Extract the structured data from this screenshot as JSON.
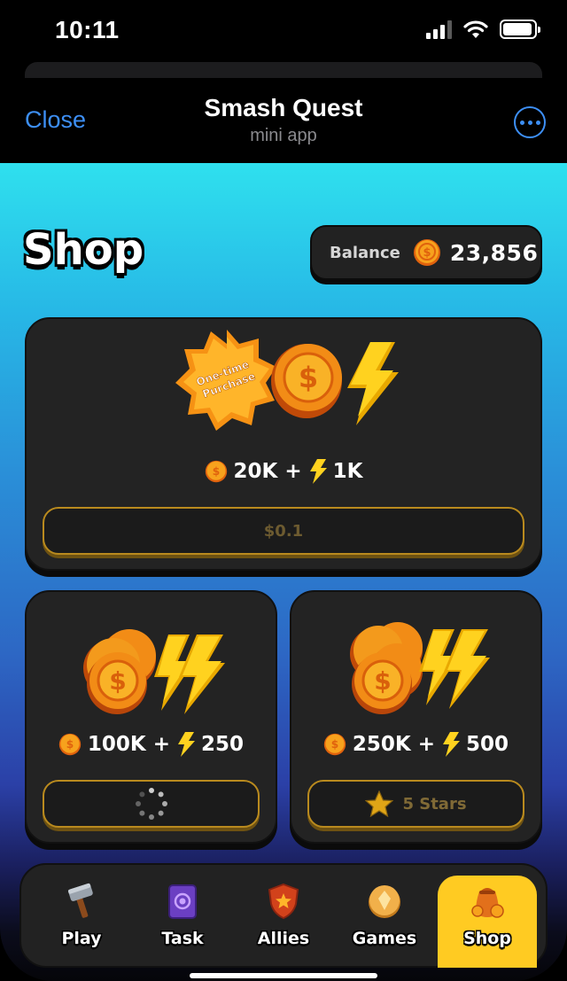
{
  "status_bar": {
    "time": "10:11"
  },
  "header": {
    "close_label": "Close",
    "title": "Smash Quest",
    "subtitle": "mini app"
  },
  "shop": {
    "title": "Shop"
  },
  "balance": {
    "label": "Balance",
    "value": "23,856"
  },
  "offers": [
    {
      "badge_text": "One-time Purchase",
      "coins": "20K",
      "energy": "1K",
      "plus": "+",
      "button_label": "$0.1",
      "button_state": "price"
    },
    {
      "coins": "100K",
      "energy": "250",
      "plus": "+",
      "button_state": "loading"
    },
    {
      "coins": "250K",
      "energy": "500",
      "plus": "+",
      "button_label": "5 Stars",
      "button_state": "stars"
    }
  ],
  "nav": {
    "items": [
      {
        "label": "Play",
        "icon": "hammer-icon",
        "active": false
      },
      {
        "label": "Task",
        "icon": "task-book-icon",
        "active": false
      },
      {
        "label": "Allies",
        "icon": "shield-icon",
        "active": false
      },
      {
        "label": "Games",
        "icon": "coin-gem-icon",
        "active": false
      },
      {
        "label": "Shop",
        "icon": "coin-bag-icon",
        "active": true
      }
    ]
  },
  "colors": {
    "accent_blue": "#3d8ff5",
    "active_tab": "#ffcb22",
    "card_bg": "#232323",
    "button_border": "#b98a1e",
    "coin": "#f39a1c",
    "bolt": "#ffd21f"
  }
}
